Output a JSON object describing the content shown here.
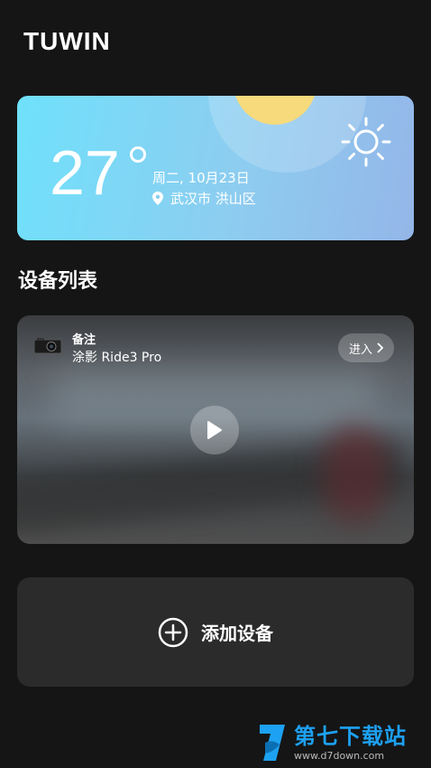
{
  "app": {
    "logo": "TUWIN"
  },
  "weather": {
    "temperature": "27",
    "date": "周二, 10月23日",
    "location": "武汉市 洪山区",
    "icon": "sun-icon"
  },
  "device_list": {
    "title": "设备列表",
    "devices": [
      {
        "note": "备注",
        "model": "涂影 Ride3 Pro",
        "enter_label": "进入"
      }
    ]
  },
  "add_device": {
    "label": "添加设备",
    "icon": "plus-circle-icon"
  },
  "watermark": {
    "name": "第七下载站",
    "url": "www.d7down.com",
    "color": "#1da1f2"
  },
  "colors": {
    "background": "#151515",
    "card": "#2b2b2b",
    "sun": "#f6da7b"
  }
}
